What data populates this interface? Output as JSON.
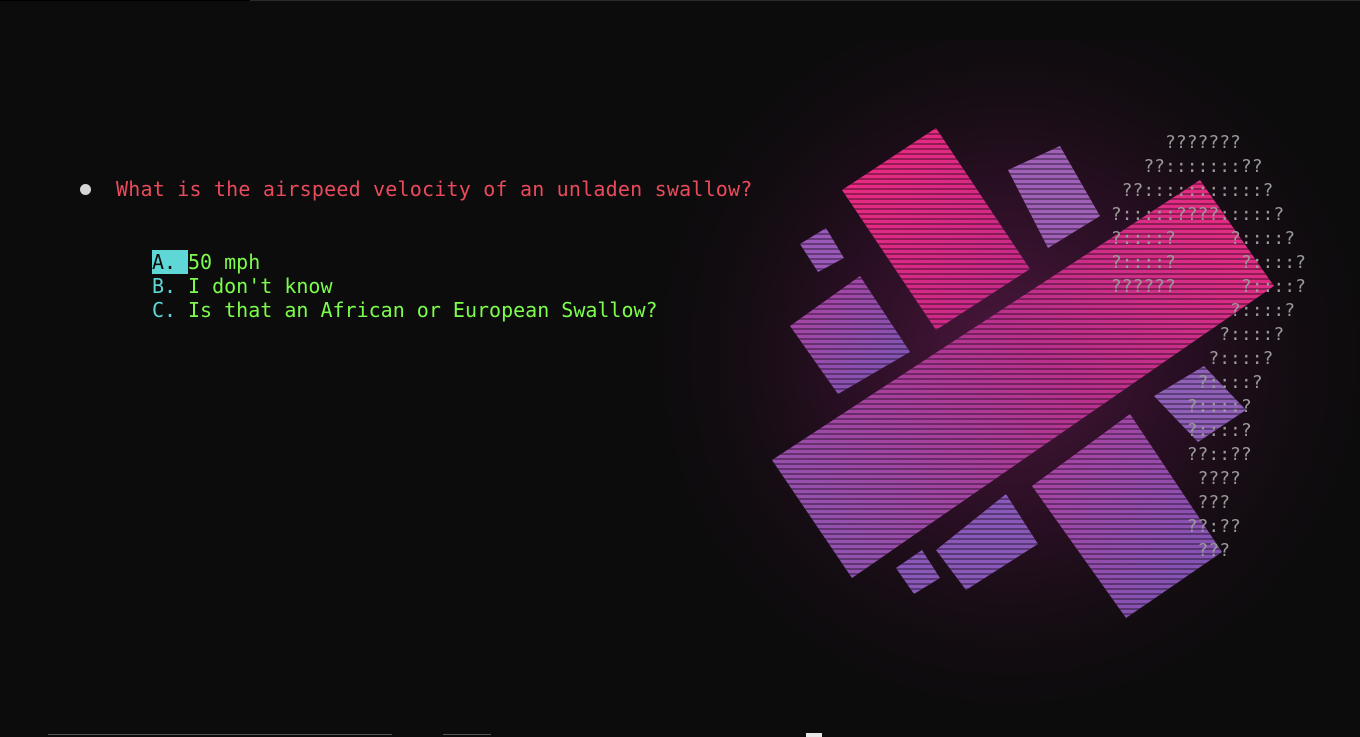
{
  "question": {
    "text": "What is the airspeed velocity of an unladen swallow?"
  },
  "answers": [
    {
      "key": "A.",
      "text": "50 mph",
      "selected": true
    },
    {
      "key": "B.",
      "text": "I don't know",
      "selected": false
    },
    {
      "key": "C.",
      "text": "Is that an African or European Swallow?",
      "selected": false
    }
  ],
  "ascii_art": [
    "      ???????",
    "    ??:::::::??",
    "  ??:::::::::::?",
    " ?:::::????:::::?",
    " ?::::?     ?::::?",
    " ?::::?      ?::::?",
    " ??????      ?::::?",
    "            ?::::?",
    "           ?::::?",
    "          ?::::?",
    "         ?::::?",
    "        ?::::?",
    "        ?::::?",
    "        ??::??",
    "         ????",
    "         ???",
    "        ??:??",
    "         ???"
  ],
  "colors": {
    "background": "#0c0c0c",
    "question": "#e94a5c",
    "answer_key": "#5fd7d7",
    "answer_text": "#7cfc4c",
    "bullet": "#d6d6d6",
    "ascii": "#9a9a9a",
    "art_pink": "#e8247a",
    "art_purple": "#8a5ab8"
  },
  "icons": {
    "bullet": "bullet-dot-icon",
    "background_art": "abstract-logo-icon"
  }
}
